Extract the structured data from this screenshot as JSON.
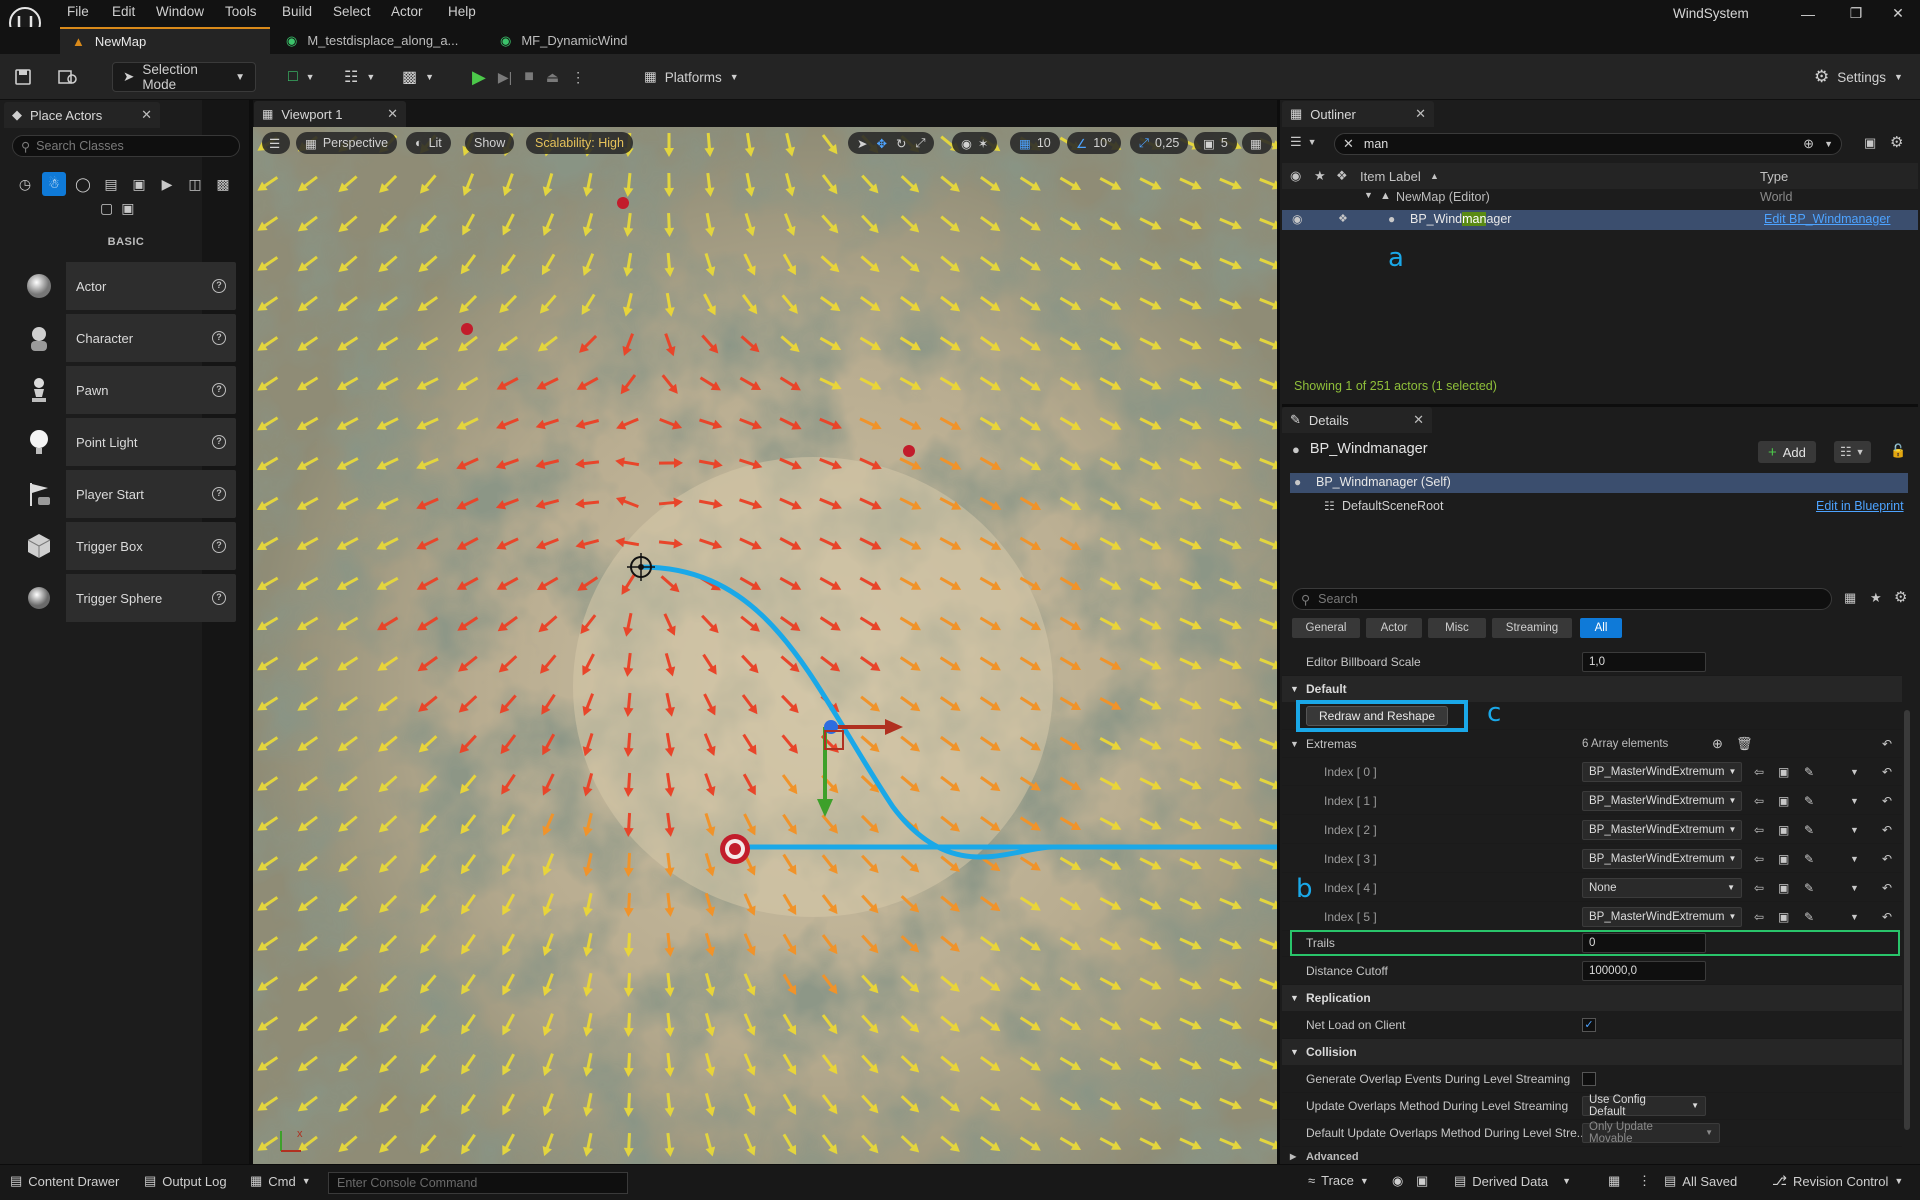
{
  "menubar": {
    "items": [
      "File",
      "Edit",
      "Window",
      "Tools",
      "Build",
      "Select",
      "Actor",
      "Help"
    ],
    "project_name": "WindSystem"
  },
  "document_tabs": [
    {
      "label": "NewMap",
      "active": true
    },
    {
      "label": "M_testdisplace_along_a...",
      "active": false
    },
    {
      "label": "MF_DynamicWind",
      "active": false
    }
  ],
  "toolbar": {
    "selection_mode": "Selection Mode",
    "platforms": "Platforms",
    "settings": "Settings"
  },
  "place_actors": {
    "tab_label": "Place Actors",
    "search_placeholder": "Search Classes",
    "section_label": "BASIC",
    "items": [
      "Actor",
      "Character",
      "Pawn",
      "Point Light",
      "Player Start",
      "Trigger Box",
      "Trigger Sphere"
    ]
  },
  "viewport": {
    "tab_label": "Viewport 1",
    "perspective": "Perspective",
    "lit": "Lit",
    "show": "Show",
    "scalability": "Scalability: High",
    "grid_snap": "10",
    "rotation_snap": "10°",
    "scale_snap": "0,25",
    "camera_speed": "5"
  },
  "outliner": {
    "tab_label": "Outliner",
    "search_value": "man",
    "col_label": "Item Label",
    "col_type": "Type",
    "rows": [
      {
        "label": "NewMap (Editor)",
        "type": "World"
      },
      {
        "label_pre": "BP_Wind",
        "label_match": "man",
        "label_post": "ager",
        "type": "Edit BP_Windmanager"
      }
    ],
    "status": "Showing 1 of 251 actors (1 selected)"
  },
  "details": {
    "tab_label": "Details",
    "object_name": "BP_Windmanager",
    "add_label": "Add",
    "components": [
      {
        "label": "BP_Windmanager (Self)"
      },
      {
        "label": "DefaultSceneRoot",
        "action": "Edit in Blueprint"
      }
    ],
    "search_placeholder": "Search",
    "filters": [
      "General",
      "Actor",
      "Misc",
      "Streaming",
      "All"
    ],
    "editor_billboard_scale": {
      "label": "Editor Billboard Scale",
      "value": "1,0"
    },
    "category_default": "Default",
    "redraw_button": "Redraw and Reshape",
    "extremas": {
      "label": "Extremas",
      "count": "6 Array elements",
      "elements": [
        {
          "index": "Index [ 0 ]",
          "value": "BP_MasterWindExtremum"
        },
        {
          "index": "Index [ 1 ]",
          "value": "BP_MasterWindExtremum"
        },
        {
          "index": "Index [ 2 ]",
          "value": "BP_MasterWindExtremum"
        },
        {
          "index": "Index [ 3 ]",
          "value": "BP_MasterWindExtremum"
        },
        {
          "index": "Index [ 4 ]",
          "value": "None"
        },
        {
          "index": "Index [ 5 ]",
          "value": "BP_MasterWindExtremum"
        }
      ]
    },
    "trails": {
      "label": "Trails",
      "value": "0"
    },
    "distance_cutoff": {
      "label": "Distance Cutoff",
      "value": "100000,0"
    },
    "category_replication": "Replication",
    "net_load": {
      "label": "Net Load on Client",
      "checked": true
    },
    "category_collision": "Collision",
    "gen_overlap": {
      "label": "Generate Overlap Events During Level Streaming",
      "checked": false
    },
    "update_overlap": {
      "label": "Update Overlaps Method During Level Streaming",
      "value": "Use Config Default"
    },
    "default_update_overlap": {
      "label": "Default Update Overlaps Method During Level Stre...",
      "value": "Only Update Movable"
    },
    "category_advanced": "Advanced"
  },
  "annotations": {
    "a": "a",
    "b": "b",
    "c": "c"
  },
  "statusbar": {
    "content_drawer": "Content Drawer",
    "output_log": "Output Log",
    "cmd": "Cmd",
    "console_placeholder": "Enter Console Command",
    "trace": "Trace",
    "derived_data": "Derived Data",
    "all_saved": "All Saved",
    "revision_control": "Revision Control"
  },
  "colors": {
    "accent_blue": "#1aa8e8",
    "highlight_green": "#29c46a",
    "selection": "#3b4e6e",
    "arrow_yellow": "#e8d43a",
    "arrow_orange": "#f0932a",
    "arrow_red": "#e8452a"
  }
}
